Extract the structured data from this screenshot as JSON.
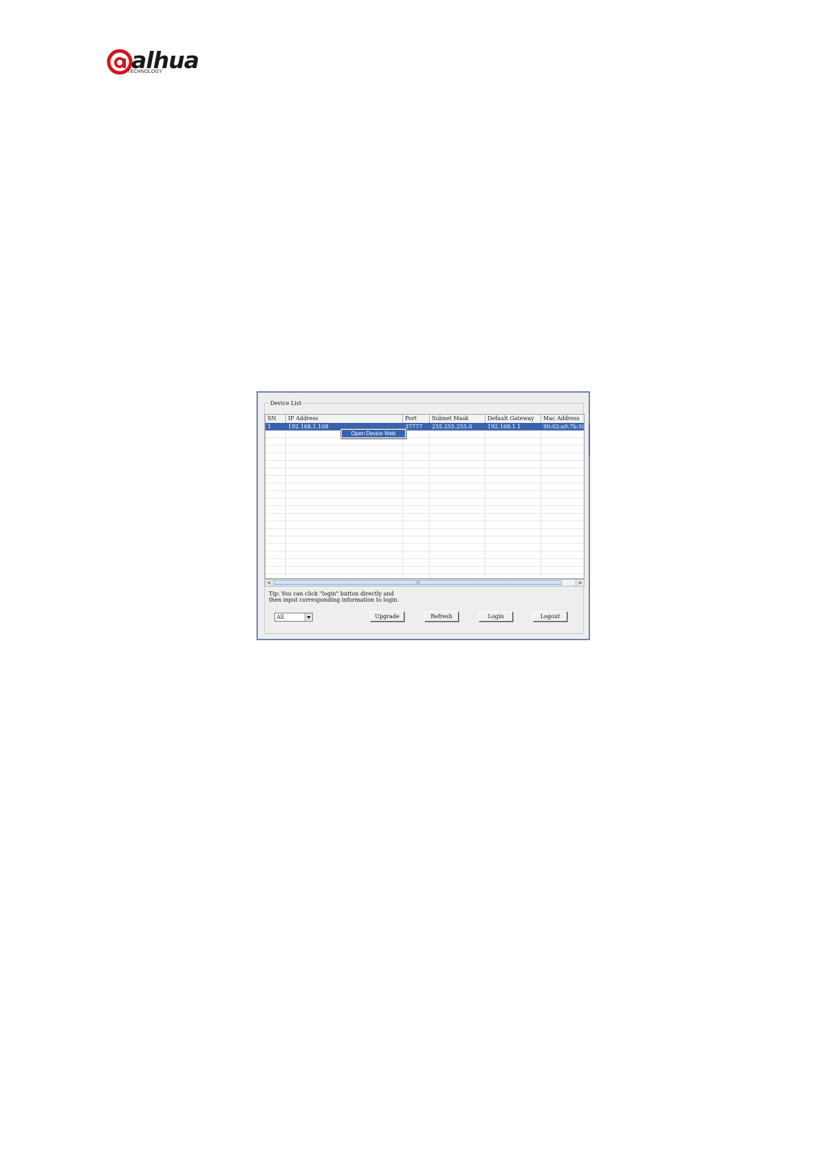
{
  "logo": {
    "wordmark": "alhua",
    "tagline": "TECHNOLOGY",
    "brand_color": "#d5141a"
  },
  "window": {
    "group_title": "Device List",
    "table": {
      "columns": [
        "SN",
        "IP Address",
        "Port",
        "Subnet Mask",
        "Default Gateway",
        "Mac Address"
      ],
      "rows": [
        [
          "1",
          "192.168.1.108",
          "37777",
          "255.255.255.0",
          "192.168.1.1",
          "90:02:a9:7b:50"
        ]
      ],
      "selected_row_color": "#3b62ad"
    },
    "context_menu": {
      "items": [
        "Open Device Web"
      ]
    },
    "scrollbar": {
      "left_arrow": "<",
      "right_arrow": ">",
      "grip": "III"
    },
    "tip": {
      "line1": "Tip: You can click \"login\" button directly and",
      "line2": "then input corresponding information to login."
    },
    "filter": {
      "selected": "All"
    },
    "buttons": {
      "upgrade": "Upgrade",
      "refresh": "Refresh",
      "login": "Login",
      "logout": "Logout"
    }
  }
}
